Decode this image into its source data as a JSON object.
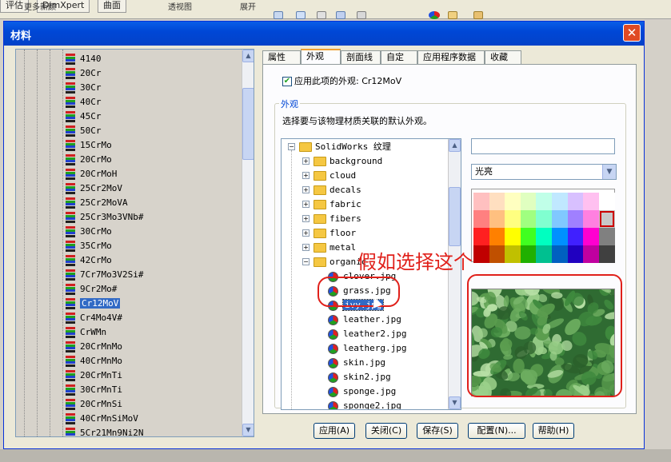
{
  "topbar": {
    "tabs": [
      "评估",
      "DimXpert",
      "曲面"
    ],
    "toolbar_items": [
      "更多新颜",
      "透视图",
      "展开"
    ]
  },
  "window": {
    "title": "材料",
    "close_label": "✕"
  },
  "materials": {
    "items": [
      "4140",
      "20Cr",
      "30Cr",
      "40Cr",
      "45Cr",
      "50Cr",
      "15CrMo",
      "20CrMo",
      "20CrMoH",
      "25Cr2MoV",
      "25Cr2MoVA",
      "25Cr3Mo3VNb#",
      "30CrMo",
      "35CrMo",
      "42CrMo",
      "7Cr7Mo3V2Si#",
      "9Cr2Mo#",
      "Cr12MoV",
      "Cr4Mo4V#",
      "CrWMn",
      "20CrMnMo",
      "40CrMnMo",
      "20CrMnTi",
      "30CrMnTi",
      "20CrMnSi",
      "40CrMnSiMoV",
      "5Cr21Mn9Ni2N"
    ],
    "selected": "Cr12MoV"
  },
  "tabs": [
    "属性",
    "外观",
    "剖面线",
    "自定义",
    "应用程序数据",
    "收藏"
  ],
  "active_tab": "外观",
  "appearance": {
    "apply_checkbox_label": "应用此项的外观: Cr12MoV",
    "apply_checked": true,
    "group_title": "外观",
    "description": "选择要与该物理材质关联的默认外观。",
    "tree": {
      "root": "SolidWorks 纹理",
      "folders": [
        "background",
        "cloud",
        "decals",
        "fabric",
        "fibers",
        "floor",
        "metal",
        "organic"
      ],
      "files": [
        "clover.jpg",
        "grass.jpg",
        "ivy.jpg",
        "leather.jpg",
        "leather2.jpg",
        "leatherg.jpg",
        "skin.jpg",
        "skin2.jpg",
        "sponge.jpg",
        "sponge2.jpg"
      ],
      "selected": "ivy.jpg"
    },
    "name_value": "",
    "finish_select": "光亮",
    "palette": [
      [
        "#ffc0c0",
        "#ffdfc0",
        "#ffffc0",
        "#e0ffc0",
        "#c0ffe8",
        "#c0e8ff",
        "#d8c0ff",
        "#ffc0f0",
        "#ffffff"
      ],
      [
        "#ff8080",
        "#ffc080",
        "#ffff80",
        "#a0ff80",
        "#80ffd0",
        "#80c8ff",
        "#a080ff",
        "#ff80e0",
        "#c8c8c8"
      ],
      [
        "#ff2020",
        "#ff8000",
        "#ffff00",
        "#40ff20",
        "#00ffc0",
        "#0090ff",
        "#4020ff",
        "#ff00d0",
        "#808080"
      ],
      [
        "#c00000",
        "#c05000",
        "#c0c000",
        "#20b000",
        "#00c090",
        "#0060c0",
        "#2000c0",
        "#c000a0",
        "#404040"
      ]
    ],
    "palette_selected": [
      1,
      8
    ],
    "preview_name": "ivy-texture-preview"
  },
  "buttons": {
    "apply": "应用(A)",
    "close": "关闭(C)",
    "save": "保存(S)",
    "config": "配置(N)...",
    "help": "帮助(H)"
  },
  "annotation": {
    "text": "假如选择这个",
    "color": "#e0201a"
  }
}
